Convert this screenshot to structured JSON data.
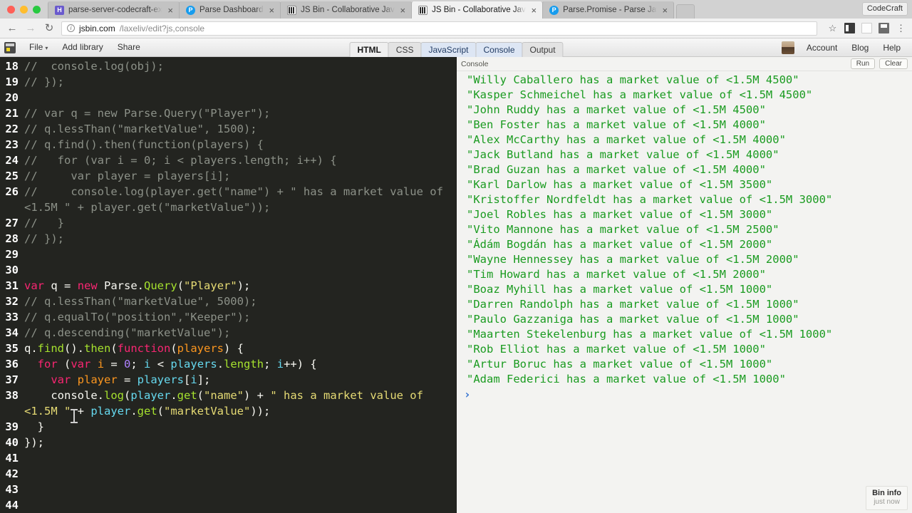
{
  "browser": {
    "tabs": [
      {
        "title": "parse-server-codecraft-examp",
        "favicon": "h-icon",
        "active": false
      },
      {
        "title": "Parse Dashboard",
        "favicon": "parse-icon",
        "active": false
      },
      {
        "title": "JS Bin - Collaborative JavaScr",
        "favicon": "jsbin-icon",
        "active": false
      },
      {
        "title": "JS Bin - Collaborative JavaScr",
        "favicon": "jsbin-icon",
        "active": true
      },
      {
        "title": "Parse.Promise - Parse JavaScr",
        "favicon": "parse-icon",
        "active": false
      }
    ],
    "close_glyph": "×",
    "profile_badge": "CodeCraft",
    "nav": {
      "back": "←",
      "forward": "→",
      "reload": "↻"
    },
    "url": {
      "host": "jsbin.com",
      "rest": "/laxeliv/edit?js,console"
    },
    "omni_icons": [
      "star-icon",
      "extension-icon",
      "blank-extension-icon",
      "extension-2-icon",
      "chrome-menu-icon"
    ],
    "star_glyph": "☆",
    "menu_glyph": "⋮"
  },
  "jsbin": {
    "menus": [
      {
        "label": "File",
        "caret": true
      },
      {
        "label": "Add library",
        "caret": false
      },
      {
        "label": "Share",
        "caret": false
      }
    ],
    "caret_glyph": "▾",
    "panel_tabs": [
      {
        "label": "HTML",
        "state": "bold"
      },
      {
        "label": "CSS",
        "state": "off"
      },
      {
        "label": "JavaScript",
        "state": "on"
      },
      {
        "label": "Console",
        "state": "on"
      },
      {
        "label": "Output",
        "state": "off"
      }
    ],
    "account_links": [
      "Account",
      "Blog",
      "Help"
    ],
    "bin_info": {
      "title": "Bin info",
      "subtitle": "just now"
    }
  },
  "editor": {
    "lines": [
      {
        "n": "18",
        "tokens": [
          {
            "t": "//  console.log(obj);",
            "c": "cmt"
          }
        ]
      },
      {
        "n": "19",
        "tokens": [
          {
            "t": "// });",
            "c": "cmt"
          }
        ]
      },
      {
        "n": "20",
        "tokens": [
          {
            "t": "",
            "c": "cmt"
          }
        ]
      },
      {
        "n": "21",
        "tokens": [
          {
            "t": "// var q = new Parse.Query(\"Player\");",
            "c": "cmt"
          }
        ]
      },
      {
        "n": "22",
        "tokens": [
          {
            "t": "// q.lessThan(\"marketValue\", 1500);",
            "c": "cmt"
          }
        ]
      },
      {
        "n": "23",
        "tokens": [
          {
            "t": "// q.find().then(function(players) {",
            "c": "cmt"
          }
        ]
      },
      {
        "n": "24",
        "tokens": [
          {
            "t": "//   for (var i = 0; i < players.length; i++) {",
            "c": "cmt"
          }
        ]
      },
      {
        "n": "25",
        "tokens": [
          {
            "t": "//     var player = players[i];",
            "c": "cmt"
          }
        ]
      },
      {
        "n": "26",
        "tokens": [
          {
            "t": "//     console.log(player.get(\"name\") + \" has a market value of <1.5M \" + player.get(\"marketValue\"));",
            "c": "cmt"
          }
        ]
      },
      {
        "n": "27",
        "tokens": [
          {
            "t": "//   }",
            "c": "cmt"
          }
        ]
      },
      {
        "n": "28",
        "tokens": [
          {
            "t": "// });",
            "c": "cmt"
          }
        ]
      },
      {
        "n": "29",
        "tokens": [
          {
            "t": "",
            "c": "def"
          }
        ]
      },
      {
        "n": "30",
        "tokens": [
          {
            "t": "",
            "c": "def"
          }
        ]
      },
      {
        "n": "31",
        "tokens": [
          {
            "t": "var",
            "c": "kw"
          },
          {
            "t": " q ",
            "c": "def"
          },
          {
            "t": "=",
            "c": "op"
          },
          {
            "t": " ",
            "c": "def"
          },
          {
            "t": "new",
            "c": "kw"
          },
          {
            "t": " Parse.",
            "c": "def"
          },
          {
            "t": "Query",
            "c": "fn"
          },
          {
            "t": "(",
            "c": "def"
          },
          {
            "t": "\"Player\"",
            "c": "str"
          },
          {
            "t": ");",
            "c": "def"
          }
        ]
      },
      {
        "n": "32",
        "tokens": [
          {
            "t": "// q.lessThan(\"marketValue\", 5000);",
            "c": "cmt"
          }
        ]
      },
      {
        "n": "33",
        "tokens": [
          {
            "t": "// q.equalTo(\"position\",\"Keeper\");",
            "c": "cmt"
          }
        ]
      },
      {
        "n": "34",
        "tokens": [
          {
            "t": "// q.descending(\"marketValue\");",
            "c": "cmt"
          }
        ]
      },
      {
        "n": "35",
        "tokens": [
          {
            "t": "q.",
            "c": "def"
          },
          {
            "t": "find",
            "c": "fn"
          },
          {
            "t": "().",
            "c": "def"
          },
          {
            "t": "then",
            "c": "fn"
          },
          {
            "t": "(",
            "c": "def"
          },
          {
            "t": "function",
            "c": "kw"
          },
          {
            "t": "(",
            "c": "def"
          },
          {
            "t": "players",
            "c": "par"
          },
          {
            "t": ") {",
            "c": "def"
          }
        ]
      },
      {
        "n": "36",
        "tokens": [
          {
            "t": "  ",
            "c": "def"
          },
          {
            "t": "for",
            "c": "kw"
          },
          {
            "t": " (",
            "c": "def"
          },
          {
            "t": "var",
            "c": "kw"
          },
          {
            "t": " ",
            "c": "def"
          },
          {
            "t": "i",
            "c": "par"
          },
          {
            "t": " = ",
            "c": "def"
          },
          {
            "t": "0",
            "c": "num"
          },
          {
            "t": "; ",
            "c": "def"
          },
          {
            "t": "i",
            "c": "var2"
          },
          {
            "t": " < ",
            "c": "def"
          },
          {
            "t": "players",
            "c": "var2"
          },
          {
            "t": ".",
            "c": "def"
          },
          {
            "t": "length",
            "c": "fn"
          },
          {
            "t": "; ",
            "c": "def"
          },
          {
            "t": "i",
            "c": "var2"
          },
          {
            "t": "++) {",
            "c": "def"
          }
        ]
      },
      {
        "n": "37",
        "tokens": [
          {
            "t": "    ",
            "c": "def"
          },
          {
            "t": "var",
            "c": "kw"
          },
          {
            "t": " ",
            "c": "def"
          },
          {
            "t": "player",
            "c": "par"
          },
          {
            "t": " = ",
            "c": "def"
          },
          {
            "t": "players",
            "c": "var2"
          },
          {
            "t": "[",
            "c": "def"
          },
          {
            "t": "i",
            "c": "var2"
          },
          {
            "t": "];",
            "c": "def"
          }
        ]
      },
      {
        "n": "38",
        "tokens": [
          {
            "t": "    console.",
            "c": "def"
          },
          {
            "t": "log",
            "c": "fn"
          },
          {
            "t": "(",
            "c": "def"
          },
          {
            "t": "player",
            "c": "var2"
          },
          {
            "t": ".",
            "c": "def"
          },
          {
            "t": "get",
            "c": "fn"
          },
          {
            "t": "(",
            "c": "def"
          },
          {
            "t": "\"name\"",
            "c": "str"
          },
          {
            "t": ") + ",
            "c": "def"
          },
          {
            "t": "\" has a market value of <1.5M \"",
            "c": "str"
          },
          {
            "t": " + ",
            "c": "def"
          },
          {
            "t": "player",
            "c": "var2"
          },
          {
            "t": ".",
            "c": "def"
          },
          {
            "t": "get",
            "c": "fn"
          },
          {
            "t": "(",
            "c": "def"
          },
          {
            "t": "\"marketValue\"",
            "c": "str"
          },
          {
            "t": "));",
            "c": "def"
          }
        ]
      },
      {
        "n": "39",
        "tokens": [
          {
            "t": "  }",
            "c": "def"
          }
        ]
      },
      {
        "n": "40",
        "tokens": [
          {
            "t": "});",
            "c": "def"
          }
        ]
      },
      {
        "n": "41",
        "tokens": [
          {
            "t": "",
            "c": "def"
          }
        ]
      },
      {
        "n": "42",
        "tokens": [
          {
            "t": "",
            "c": "def"
          }
        ]
      },
      {
        "n": "43",
        "tokens": [
          {
            "t": "",
            "c": "def"
          }
        ]
      },
      {
        "n": "44",
        "tokens": [
          {
            "t": "",
            "c": "def"
          }
        ]
      }
    ]
  },
  "console": {
    "label": "Console",
    "run_label": "Run",
    "clear_label": "Clear",
    "prompt_glyph": "›",
    "output": [
      "\"Willy Caballero has a market value of <1.5M 4500\"",
      "\"Kasper Schmeichel has a market value of <1.5M 4500\"",
      "\"John Ruddy has a market value of <1.5M 4500\"",
      "\"Ben Foster has a market value of <1.5M 4000\"",
      "\"Alex McCarthy has a market value of <1.5M 4000\"",
      "\"Jack Butland has a market value of <1.5M 4000\"",
      "\"Brad Guzan has a market value of <1.5M 4000\"",
      "\"Karl Darlow has a market value of <1.5M 3500\"",
      "\"Kristoffer Nordfeldt has a market value of <1.5M 3000\"",
      "\"Joel Robles has a market value of <1.5M 3000\"",
      "\"Vito Mannone has a market value of <1.5M 2500\"",
      "\"Ádám Bogdán has a market value of <1.5M 2000\"",
      "\"Wayne Hennessey has a market value of <1.5M 2000\"",
      "\"Tim Howard has a market value of <1.5M 2000\"",
      "\"Boaz Myhill has a market value of <1.5M 1000\"",
      "\"Darren Randolph has a market value of <1.5M 1000\"",
      "\"Paulo Gazzaniga has a market value of <1.5M 1000\"",
      "\"Maarten Stekelenburg has a market value of <1.5M 1000\"",
      "\"Rob Elliot has a market value of <1.5M 1000\"",
      "\"Artur Boruc has a market value of <1.5M 1000\"",
      "\"Adam Federici has a market value of <1.5M 1000\""
    ]
  },
  "colors": {
    "editor_bg": "#232420",
    "console_text": "#1a9b20",
    "keyword": "#f92672",
    "function": "#a6e22e",
    "string": "#e6db74",
    "number": "#ae81ff",
    "param": "#fd971f",
    "comment": "#8c9188",
    "prompt": "#2f6fd0"
  }
}
